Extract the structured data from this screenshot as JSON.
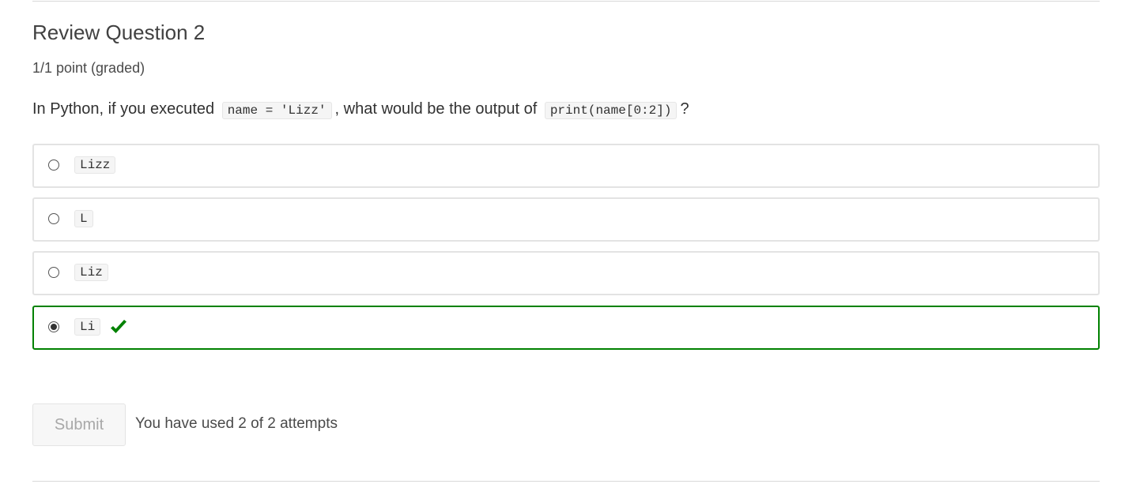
{
  "problem": {
    "title": "Review Question 2",
    "points": "1/1 point (graded)",
    "prompt": {
      "before": "In Python, if you executed ",
      "code1": "name = 'Lizz'",
      "middle": ", what would be the output of ",
      "code2": "print(name[0:2])",
      "after": "?"
    }
  },
  "choices": [
    {
      "label": "Lizz",
      "selected": false,
      "correct": false
    },
    {
      "label": "L",
      "selected": false,
      "correct": false
    },
    {
      "label": "Liz",
      "selected": false,
      "correct": false
    },
    {
      "label": "Li",
      "selected": true,
      "correct": true
    }
  ],
  "status_icons": {
    "correct": "checkmark-icon"
  },
  "colors": {
    "correct": "#008100",
    "choice_border": "#e3e3e3"
  },
  "actions": {
    "submit_label": "Submit",
    "attempts_text": "You have used 2 of 2 attempts"
  }
}
